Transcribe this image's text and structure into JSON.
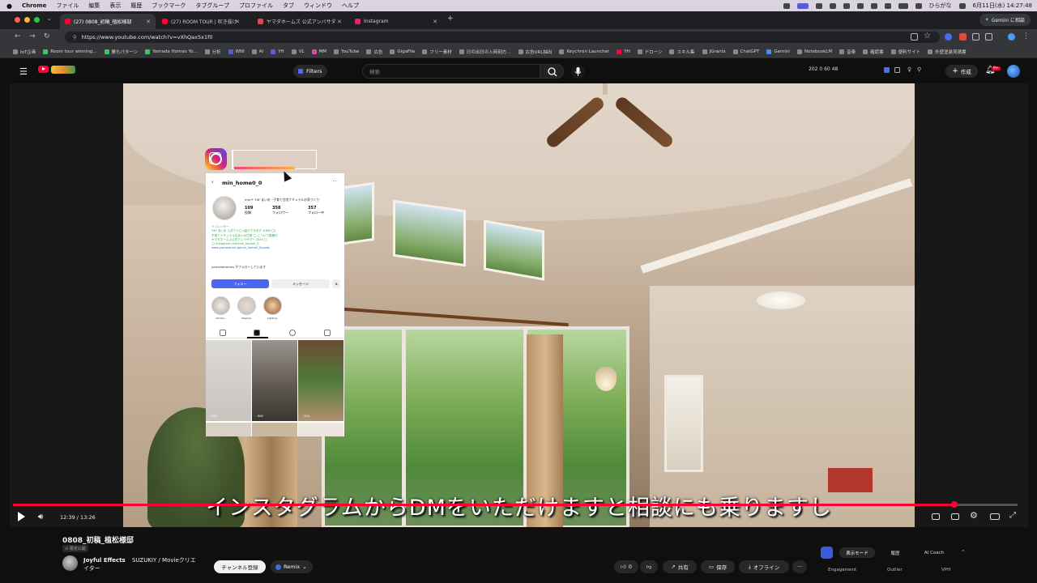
{
  "menubar": {
    "items": [
      "Chrome",
      "ファイル",
      "編集",
      "表示",
      "履歴",
      "ブックマーク",
      "タブグループ",
      "プロファイル",
      "タブ",
      "ウィンドウ",
      "ヘルプ"
    ],
    "clock": "6月11日(水) 14:27:48",
    "ime": "ひらがな"
  },
  "tabs": [
    {
      "label": "(27) 0808_初稿_植松様邸",
      "color": "#ff0033"
    },
    {
      "label": "(27) ROOM TOUR | 吹き抜け",
      "color": "#ff0033"
    },
    {
      "label": "ヤマダホームズ 公式アンバサダ",
      "color": "#e2474e"
    },
    {
      "label": "Instagram",
      "color": "#d62976"
    }
  ],
  "browser": {
    "url": "https://www.youtube.com/watch?v=vXhQax5x1f0",
    "gemini_button": "Gemini に相談"
  },
  "bookmarks": [
    {
      "label": "IoT企画",
      "color": "#888"
    },
    {
      "label": "Room tour winning...",
      "color": "#3cc36b"
    },
    {
      "label": "勝ちパターン",
      "color": "#3cc36b"
    },
    {
      "label": "Yamada Homes Yo...",
      "color": "#3cc36b"
    },
    {
      "label": "分析",
      "color": "#888"
    },
    {
      "label": "WNI",
      "color": "#5b5bd6"
    },
    {
      "label": "AI",
      "color": "#888"
    },
    {
      "label": "YH",
      "color": "#5b5bd6"
    },
    {
      "label": "VL",
      "color": "#888"
    },
    {
      "label": "MM",
      "color": "#d64ba8"
    },
    {
      "label": "YouTube",
      "color": "#888"
    },
    {
      "label": "広告",
      "color": "#888"
    },
    {
      "label": "GigaFile",
      "color": "#888"
    },
    {
      "label": "フリー素材",
      "color": "#888"
    },
    {
      "label": "日の出日の入時刻方...",
      "color": "#888"
    },
    {
      "label": "広告URL抽出",
      "color": "#888"
    },
    {
      "label": "Keychron Launcher",
      "color": "#888"
    },
    {
      "label": "YH",
      "color": "#ff0033"
    },
    {
      "label": "ドローン",
      "color": "#888"
    },
    {
      "label": "スキル集",
      "color": "#888"
    },
    {
      "label": "JGrants",
      "color": "#888"
    },
    {
      "label": "ChatGPT",
      "color": "#888"
    },
    {
      "label": "Gemini",
      "color": "#4c8bf5"
    },
    {
      "label": "NotebookLM",
      "color": "#888"
    },
    {
      "label": "音楽",
      "color": "#888"
    },
    {
      "label": "確認書",
      "color": "#888"
    },
    {
      "label": "便利サイト",
      "color": "#888"
    },
    {
      "label": "外壁塗装見積書",
      "color": "#888"
    }
  ],
  "youtube": {
    "filters": "Filters",
    "search_placeholder": "検索",
    "stats": "202   0   60   48",
    "create": "作成",
    "notifications": "9+"
  },
  "instagram": {
    "username": "min_home0_0",
    "bio_head": "min＊ Y4F まいお · 子育て住宅ナチュラルお家づくり",
    "stats": [
      {
        "value": "109",
        "label": "投稿"
      },
      {
        "value": "358",
        "label": "フォロワー"
      },
      {
        "value": "357",
        "label": "フォロー中"
      }
    ],
    "bio_lines": [
      "クリエイター",
      "Y4F まいお 公式アイ◯ (紹介できます ＃DM ◯)",
      "子育てナチュラル住まいの日常 ◯ について投稿中",
      "ヤマダホームズ公式アンバサダー 2025 ◯",
      "◯ instagram.com/min_home0_0"
    ],
    "link": "www.yamada-sxl.jp/min_home0_0/posts",
    "followed_by": "yamadahomes がフォローしています",
    "follow": "フォロー",
    "message": "メッセージ",
    "highlights": [
      "kitchen",
      "lifestyle",
      "Lighting"
    ],
    "post_counts": [
      "◦ 890",
      "◦ 880",
      "◦ 924"
    ]
  },
  "video": {
    "subtitle": "インスタグラムからDMをいただけますと相談にも乗りますし",
    "progress": 0.937,
    "time": "12:39 / 13:26"
  },
  "meta": {
    "title": "0808_初稿_植松様邸",
    "visibility": "限定公開",
    "channel": "Joyful Effects",
    "channel_line2_a": "SUZUKIY / Movieクリエ",
    "channel_line2_b": "イター",
    "subscribe": "チャンネル登録",
    "remix": "Remix",
    "likes": "0",
    "share": "共有",
    "save": "保存",
    "offline": "オフライン"
  },
  "side_panel": {
    "segments": [
      "表示モード",
      "履歴",
      "AI Coach"
    ],
    "metrics": [
      "Engagement",
      "Outlier",
      "VPH"
    ]
  }
}
